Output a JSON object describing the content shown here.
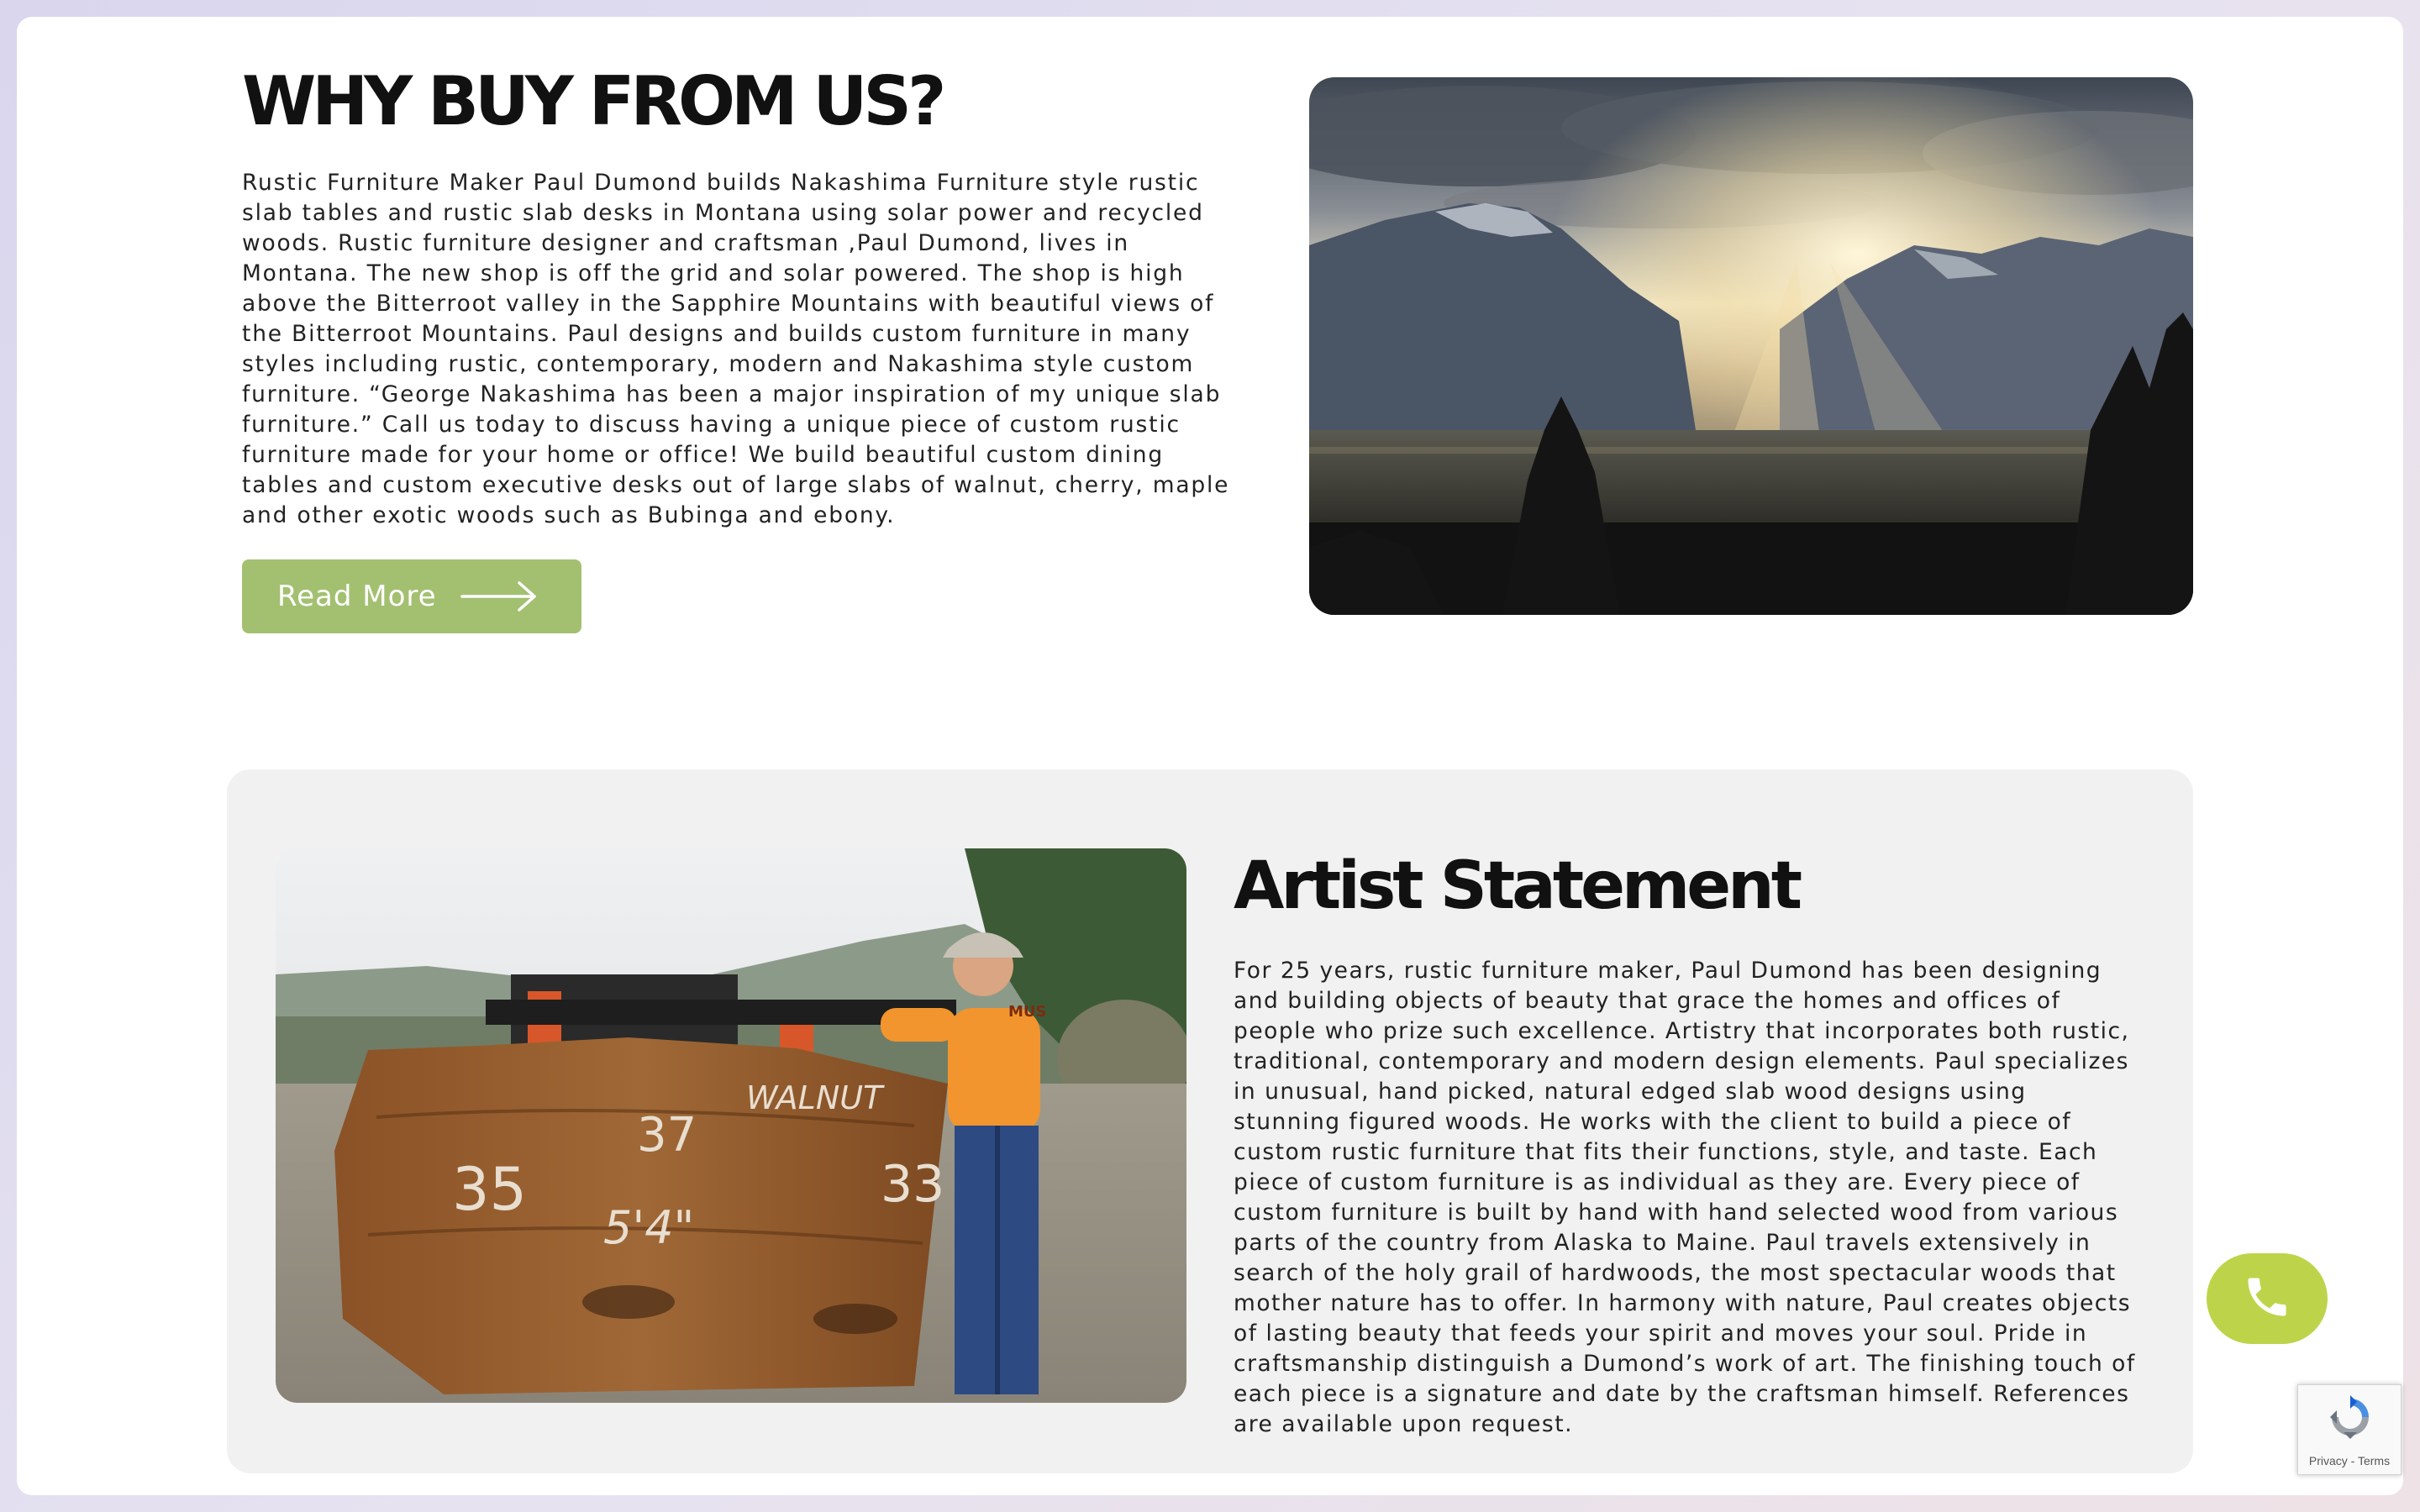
{
  "why_section": {
    "title": "WHY BUY FROM US?",
    "body": "Rustic Furniture Maker Paul Dumond builds Nakashima Furniture style rustic slab tables and rustic slab desks in Montana using solar power and recycled woods. Rustic furniture designer and craftsman ,Paul Dumond, lives in Montana. The new shop is off the grid and solar powered. The shop is high above the Bitterroot valley in the Sapphire Mountains with beautiful views of the Bitterroot Mountains. Paul designs and builds custom furniture in many styles including rustic, contemporary, modern and Nakashima style custom furniture. “George Nakashima has been a major inspiration of my unique slab furniture.” Call us today to discuss having a unique piece of custom rustic furniture made for your home or office! We build beautiful custom dining tables and custom executive desks out of large slabs of walnut, cherry, maple and other exotic woods such as Bubinga and ebony.",
    "button_label": "Read More",
    "button_icon": "arrow-right-icon",
    "image_icon": "mountain-sunrise-photo"
  },
  "artist_section": {
    "title": "Artist Statement",
    "body": "For 25 years, rustic furniture maker, Paul Dumond has been designing and building objects of beauty that grace the homes and offices of people who prize such excellence. Artistry that incorporates both rustic, traditional, contemporary and modern design elements. Paul specializes in unusual, hand picked, natural edged slab wood designs using stunning figured woods. He works with the client to build a piece of custom rustic furniture that fits their functions, style, and taste. Each piece of custom furniture is as individual as they are. Every piece of custom furniture is built by hand with hand selected wood from various parts of the country from Alaska to Maine. Paul travels extensively in search of the holy grail of hardwoods, the most spectacular woods that mother nature has to offer. In harmony with nature, Paul creates objects of lasting beauty that feeds your spirit and moves your soul. Pride in craftsmanship distinguish a Dumond’s work of art. The finishing touch of each piece is a signature and date by the craftsman himself. References are available upon request.",
    "image_icon": "walnut-slab-photo",
    "slab_text": {
      "wood": "WALNUT",
      "left": "35",
      "middle": "37",
      "right": "33",
      "length": "5'4\"",
      "shirt": "MUS"
    }
  },
  "floating": {
    "phone_icon": "phone-icon",
    "recaptcha_privacy": "Privacy",
    "recaptcha_separator": " - ",
    "recaptcha_terms": "Terms"
  },
  "colors": {
    "page_background": "#ffffff",
    "button_green": "#a3c071",
    "phone_green": "#bdd44a",
    "card_gray": "#f1f1f1",
    "text_dark": "#111111"
  }
}
